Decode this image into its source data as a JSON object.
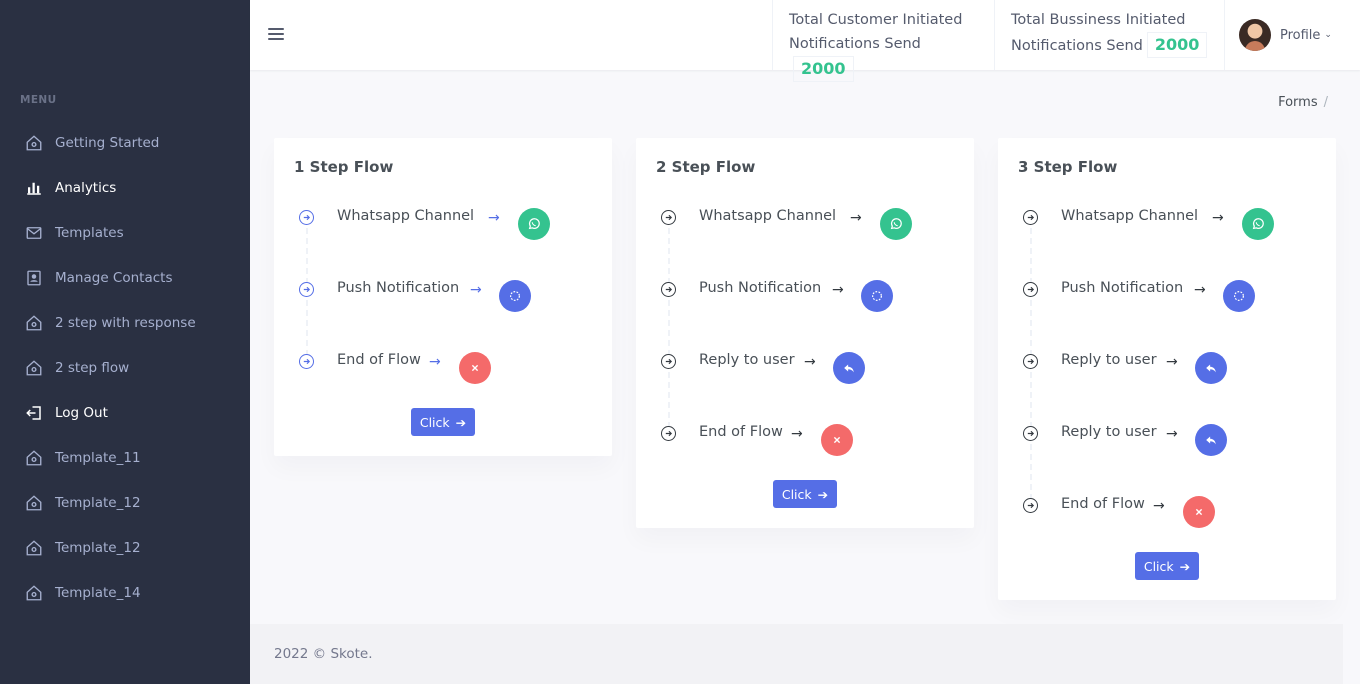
{
  "sidebar": {
    "menu_title": "MENU",
    "items": [
      {
        "label": "Getting Started",
        "icon": "home-icon"
      },
      {
        "label": "Analytics",
        "icon": "bar-chart-icon"
      },
      {
        "label": "Templates",
        "icon": "envelope-icon"
      },
      {
        "label": "Manage Contacts",
        "icon": "contact-icon"
      },
      {
        "label": "2 step with response",
        "icon": "home-icon"
      },
      {
        "label": "2 step flow",
        "icon": "home-icon"
      },
      {
        "label": "Log Out",
        "icon": "logout-icon"
      },
      {
        "label": "Template_11",
        "icon": "home-icon"
      },
      {
        "label": "Template_12",
        "icon": "home-icon"
      },
      {
        "label": "Template_12",
        "icon": "home-icon"
      },
      {
        "label": "Template_14",
        "icon": "home-icon"
      }
    ]
  },
  "topbar": {
    "stats": [
      {
        "line1": "Total Customer Initiated",
        "line2": "Notifications Send",
        "value": "2000"
      },
      {
        "line1": "Total Bussiness Initiated",
        "line2": "Notifications Send",
        "value": "2000"
      }
    ],
    "profile_label": "Profile"
  },
  "breadcrumb": {
    "item": "Forms",
    "separator": "/"
  },
  "cards": [
    {
      "title": "1 Step Flow",
      "steps": [
        {
          "label": "Whatsapp Channel",
          "badge": "whatsapp-icon"
        },
        {
          "label": "Push Notification",
          "badge": "spinner-icon"
        },
        {
          "label": "End of Flow",
          "badge": "close-icon"
        }
      ],
      "button": "Click"
    },
    {
      "title": "2 Step Flow",
      "steps": [
        {
          "label": "Whatsapp Channel",
          "badge": "whatsapp-icon"
        },
        {
          "label": "Push Notification",
          "badge": "spinner-icon"
        },
        {
          "label": "Reply to user",
          "badge": "reply-icon"
        },
        {
          "label": "End of Flow",
          "badge": "close-icon"
        }
      ],
      "button": "Click"
    },
    {
      "title": "3 Step Flow",
      "steps": [
        {
          "label": "Whatsapp Channel",
          "badge": "whatsapp-icon"
        },
        {
          "label": "Push Notification",
          "badge": "spinner-icon"
        },
        {
          "label": "Reply to user",
          "badge": "reply-icon"
        },
        {
          "label": "Reply to user",
          "badge": "reply-icon"
        },
        {
          "label": "End of Flow",
          "badge": "close-icon"
        }
      ],
      "button": "Click"
    }
  ],
  "footer": {
    "text": "2022 © Skote."
  },
  "colors": {
    "sidebar": "#2a3042",
    "primary": "#556ee6",
    "success": "#34c38f",
    "danger": "#f46a6a"
  }
}
